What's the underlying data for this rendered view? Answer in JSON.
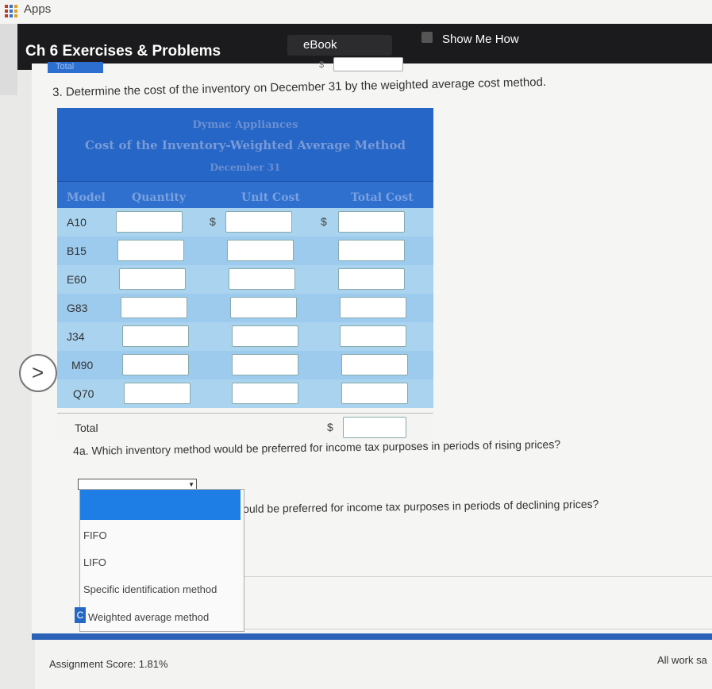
{
  "apps": {
    "label": "Apps"
  },
  "header": {
    "title": "Ch 6 Exercises & Problems",
    "ebook": "eBook",
    "show_me_how": "Show Me How"
  },
  "prev_row": {
    "label": "Total",
    "dollar": "$"
  },
  "question3": "3. Determine the cost of the inventory on December 31 by the weighted average cost method.",
  "table": {
    "company": "Dymac Appliances",
    "subtitle": "Cost of the Inventory-Weighted Average Method",
    "date": "December 31",
    "columns": [
      "Model",
      "Quantity",
      "Unit Cost",
      "Total Cost"
    ],
    "rows": [
      {
        "model": "A10",
        "unit_dollar": "$",
        "total_dollar": "$",
        "quantity": "",
        "unit_cost": "",
        "total_cost": ""
      },
      {
        "model": "B15",
        "quantity": "",
        "unit_cost": "",
        "total_cost": ""
      },
      {
        "model": "E60",
        "quantity": "",
        "unit_cost": "",
        "total_cost": ""
      },
      {
        "model": "G83",
        "quantity": "",
        "unit_cost": "",
        "total_cost": ""
      },
      {
        "model": "J34",
        "quantity": "",
        "unit_cost": "",
        "total_cost": ""
      },
      {
        "model": "M90",
        "quantity": "",
        "unit_cost": "",
        "total_cost": ""
      },
      {
        "model": "Q70",
        "quantity": "",
        "unit_cost": "",
        "total_cost": ""
      }
    ],
    "total": {
      "label": "Total",
      "dollar": "$",
      "value": ""
    }
  },
  "question4a": "4a. Which inventory method would be preferred for income tax purposes in periods of rising prices?",
  "question4b_fragment": "ould be preferred for income tax purposes in periods of declining prices?",
  "dropdown": {
    "selected": "",
    "options": [
      "FIFO",
      "LIFO",
      "Specific identification method",
      "Weighted average method"
    ],
    "cut_letter": "C"
  },
  "footer": {
    "score": "Assignment Score: 1.81%",
    "all_work": "All work sa"
  },
  "colors": {
    "header_blue": "#2566c7",
    "row_blue": "#a9d3ef",
    "highlight": "#1f7ee6"
  },
  "icons": [
    "apps-grid-icon",
    "chevron-right-icon",
    "caret-down-icon"
  ]
}
